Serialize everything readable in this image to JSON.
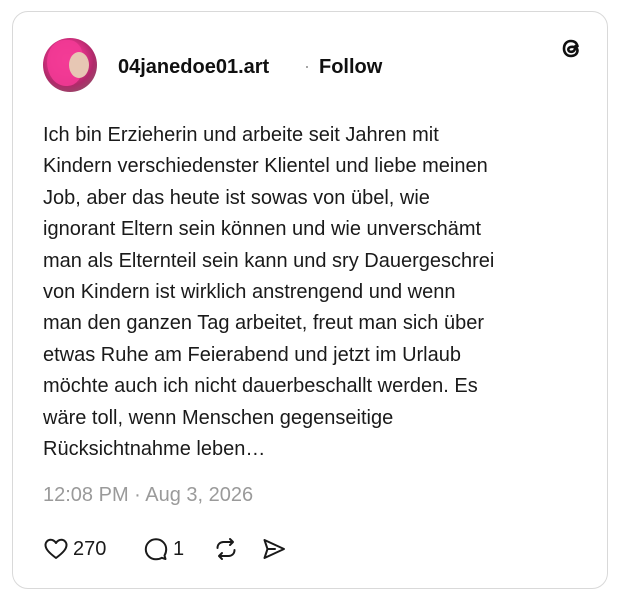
{
  "post": {
    "username": "04janedoe01.art",
    "separator": "·",
    "follow_label": "Follow",
    "text": "Ich bin Erzieherin und arbeite seit Jahren mit\nKindern verschiedenster Klientel und liebe meinen\nJob, aber das heute ist sowas von übel, wie\nignorant Eltern sein  können und wie unverschämt\nman als Elternteil sein kann und sry Dauergeschrei\nvon Kindern ist wirklich anstrengend und wenn\nman den ganzen Tag arbeitet, freut man sich über\netwas Ruhe am Feierabend und jetzt im Urlaub\nmöchte auch ich nicht dauerbeschallt werden. Es\nwäre toll, wenn Menschen gegenseitige\nRücksichtnahme leben…",
    "timestamp": "12:08 PM · Aug 3, 2026"
  },
  "actions": {
    "likes": "270",
    "replies": "1"
  },
  "icons": {
    "brand": "threads-icon",
    "like": "heart-icon",
    "reply": "comment-icon",
    "repost": "repost-icon",
    "share": "send-icon"
  },
  "colors": {
    "text": "#101010",
    "muted": "#9a9a9a",
    "border": "#d9d9d9"
  }
}
